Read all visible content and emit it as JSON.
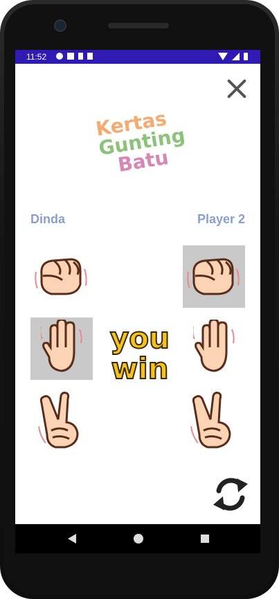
{
  "status_bar": {
    "time": "11:52",
    "icons": [
      "gear-icon",
      "image-icon",
      "download-icon",
      "sd-card-icon",
      "wifi-icon",
      "signal-icon",
      "battery-icon"
    ],
    "color": "#2f1bb3"
  },
  "header": {
    "close_icon": "close-icon"
  },
  "logo": {
    "line1": "Kertas",
    "line2": "Gunting",
    "line3": "Batu",
    "colors": [
      "#f4ab6f",
      "#8cc27a",
      "#d787b6"
    ]
  },
  "players": {
    "left": "Dinda",
    "right": "Player 2"
  },
  "choices": {
    "left": [
      {
        "icon": "fist-icon",
        "selected": false
      },
      {
        "icon": "open-hand-icon",
        "selected": true
      },
      {
        "icon": "victory-hand-icon",
        "selected": false
      }
    ],
    "right": [
      {
        "icon": "fist-icon",
        "selected": true
      },
      {
        "icon": "open-hand-icon",
        "selected": false
      },
      {
        "icon": "victory-hand-icon",
        "selected": false
      }
    ]
  },
  "result": {
    "line1": "you",
    "line2": "win",
    "color": "#f4c21c"
  },
  "refresh": {
    "icon": "refresh-icon"
  },
  "navigation": {
    "icons": [
      "back-icon",
      "home-icon",
      "recents-icon"
    ]
  }
}
